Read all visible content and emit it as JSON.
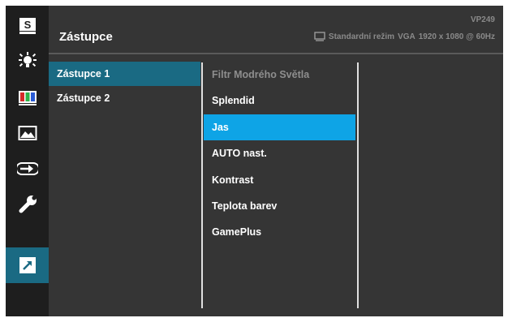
{
  "header": {
    "title": "Zástupce",
    "model": "VP249",
    "mode": "Standardní režim",
    "input": "VGA",
    "resolution": "1920 x 1080 @ 60Hz"
  },
  "sidebar": {
    "items": [
      {
        "name": "splendid",
        "icon": "s-box-icon",
        "glyph": "S"
      },
      {
        "name": "blue-light",
        "icon": "sun-bulb-icon"
      },
      {
        "name": "color",
        "icon": "color-bars-icon"
      },
      {
        "name": "image",
        "icon": "mountain-picture-icon"
      },
      {
        "name": "input",
        "icon": "input-arrow-icon"
      },
      {
        "name": "system",
        "icon": "wrench-icon"
      },
      {
        "name": "shortcut",
        "icon": "shortcut-arrow-icon",
        "active": true
      }
    ]
  },
  "submenu": {
    "items": [
      "Zástupce 1",
      "Zástupce 2"
    ],
    "selected": 0
  },
  "options": {
    "items": [
      "Filtr Modrého Světla",
      "Splendid",
      "Jas",
      "AUTO nast.",
      "Kontrast",
      "Teplota barev",
      "GamePlus"
    ],
    "disabled": 0,
    "selected": 2
  },
  "colors": {
    "accent": "#1a6a83",
    "highlight": "#0ea4e6",
    "panel": "#353535",
    "sidebar": "#1e1e1e"
  }
}
